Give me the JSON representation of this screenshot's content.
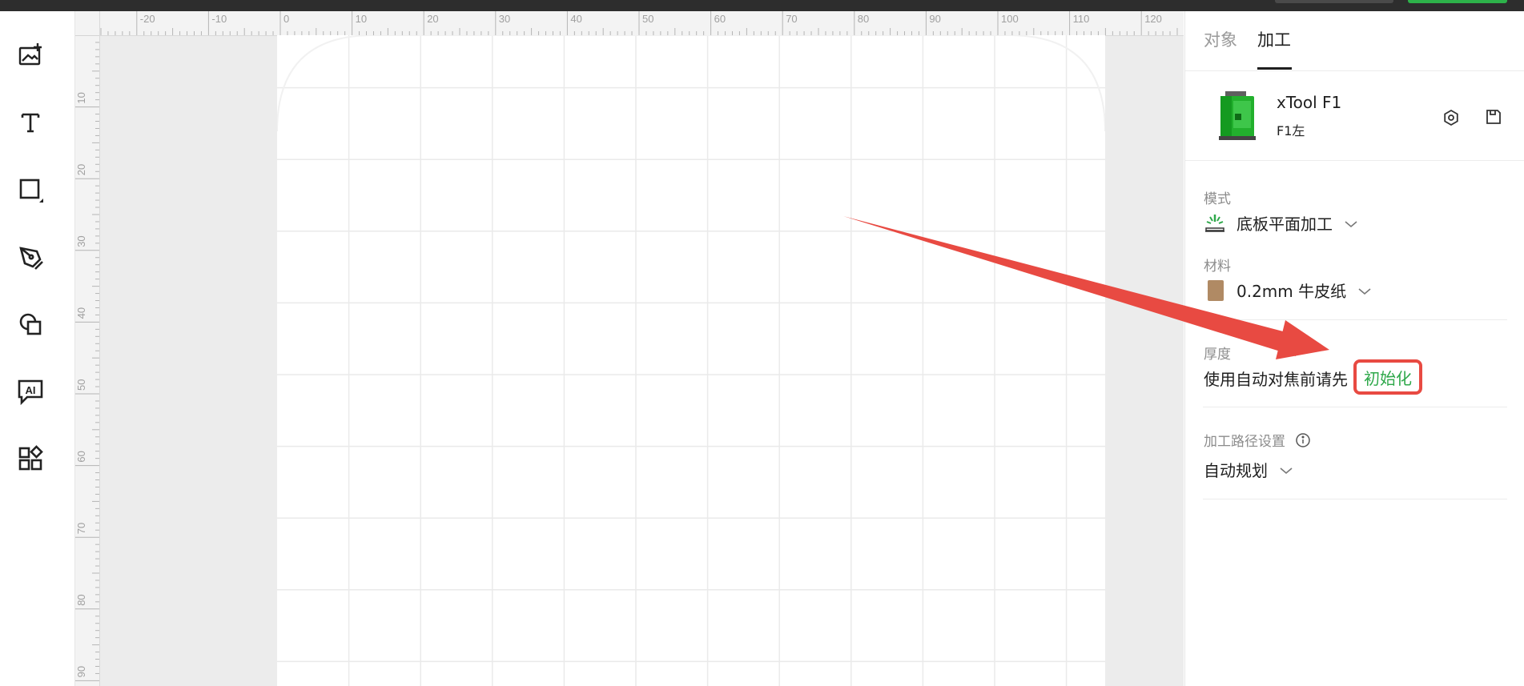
{
  "tabs": [
    {
      "label": "对象"
    },
    {
      "label": "加工"
    }
  ],
  "device": {
    "name": "xTool F1",
    "subtitle": "F1左"
  },
  "mode": {
    "label": "模式",
    "value": "底板平面加工"
  },
  "material": {
    "label": "材料",
    "value": "0.2mm 牛皮纸",
    "swatch_color": "#b08a64"
  },
  "thickness": {
    "label": "厚度",
    "message": "使用自动对焦前请先",
    "link": "初始化"
  },
  "path": {
    "label": "加工路径设置",
    "value": "自动规划"
  },
  "ruler": {
    "top": [
      "-20",
      "-10",
      "0",
      "10",
      "20",
      "30",
      "40",
      "50",
      "60",
      "70",
      "80",
      "90",
      "100",
      "110",
      "120"
    ],
    "left": [
      "10",
      "20",
      "30",
      "40",
      "50",
      "60",
      "70",
      "80",
      "90"
    ]
  },
  "toolbar": [
    "image-add-icon",
    "text-icon",
    "rectangle-icon",
    "pen-icon",
    "shapes-icon",
    "ai-icon",
    "apps-icon"
  ],
  "colors": {
    "accent_green": "#2ea84a",
    "highlight_red": "#e84a42"
  }
}
